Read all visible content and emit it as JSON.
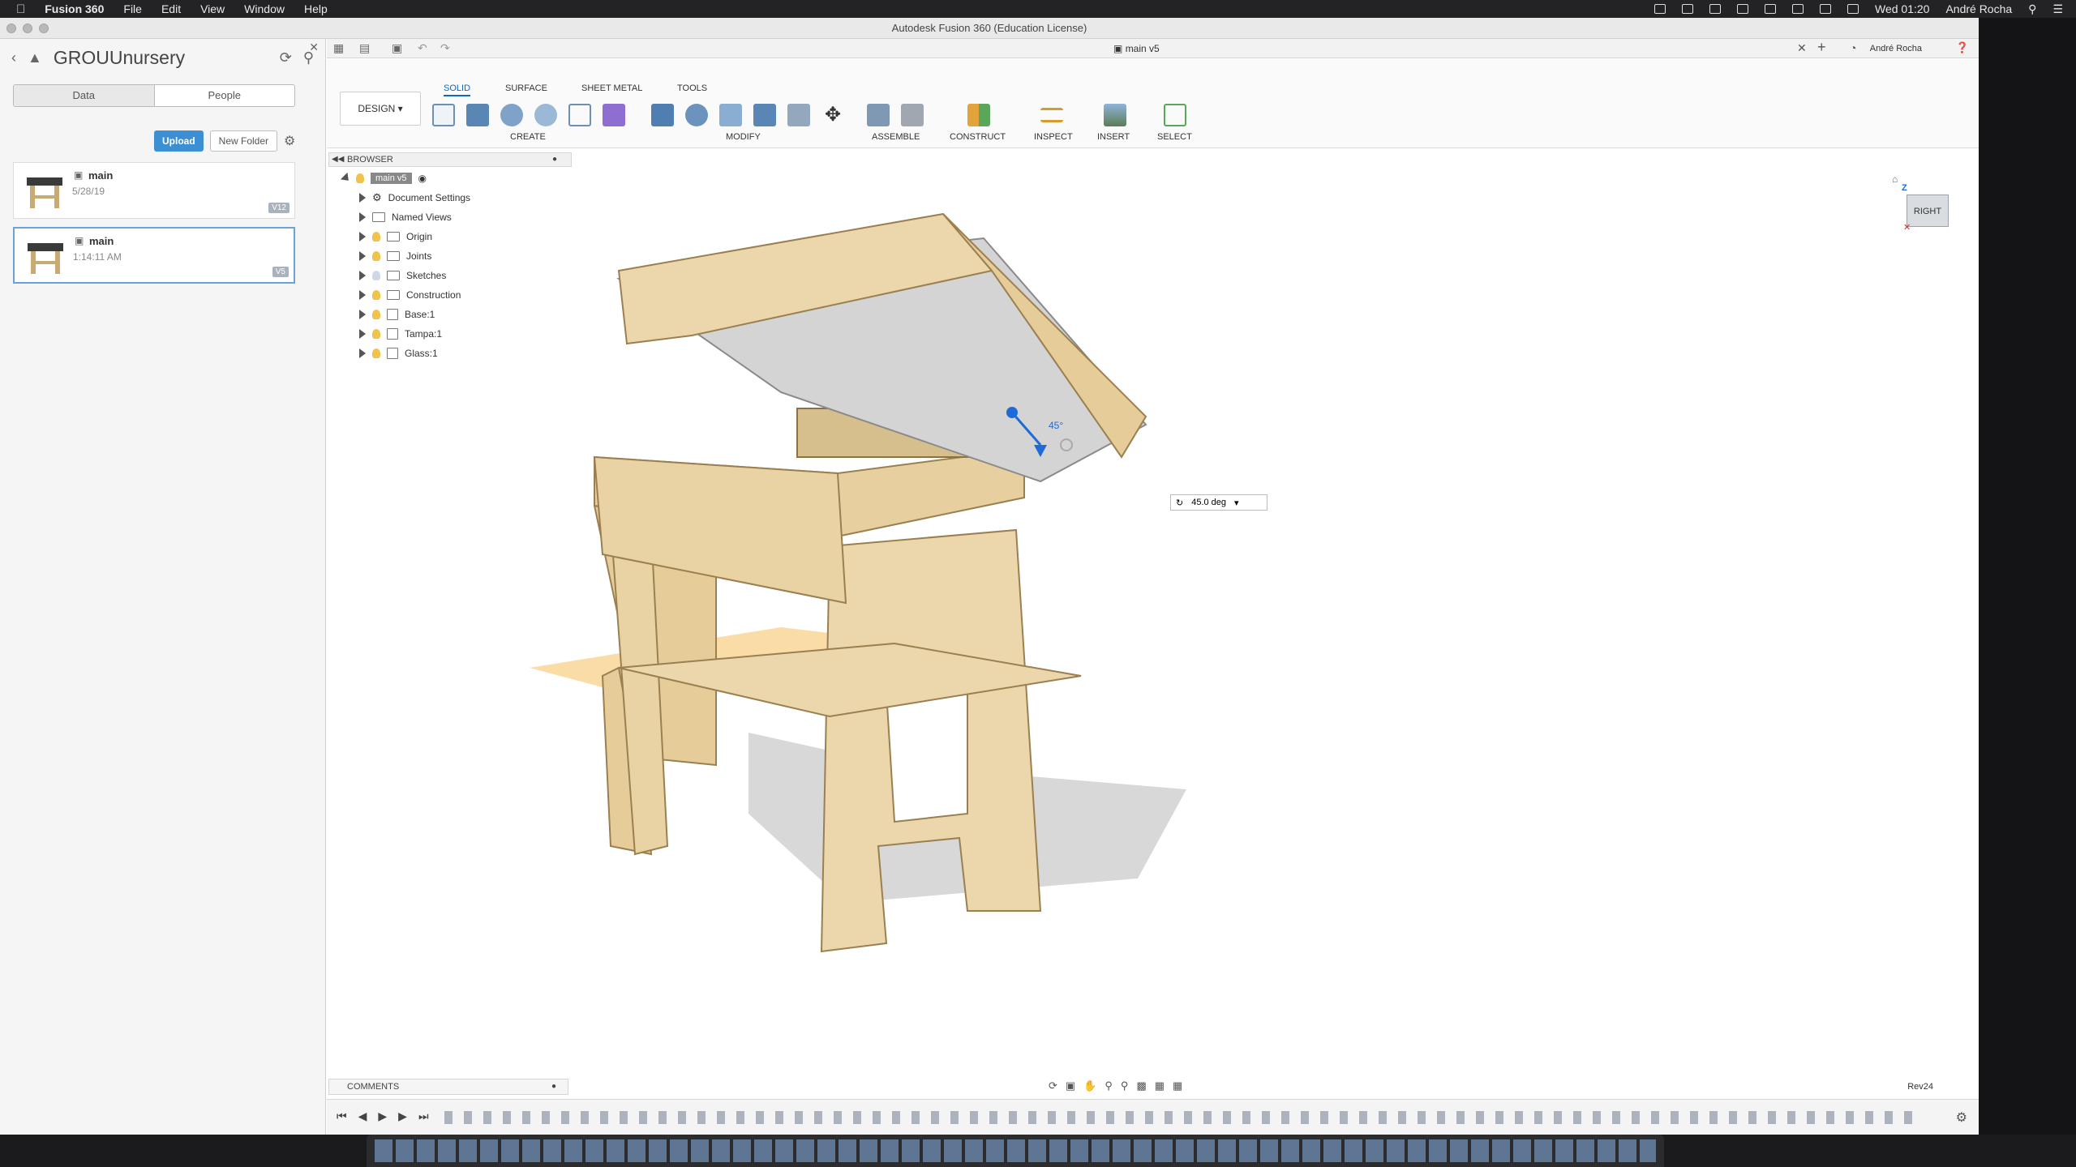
{
  "menubar": {
    "apple": "",
    "app": "Fusion 360",
    "items": [
      "File",
      "Edit",
      "View",
      "Window",
      "Help"
    ],
    "clock": "Wed 01:20",
    "user": "André Rocha"
  },
  "window": {
    "title": "Autodesk Fusion 360 (Education License)"
  },
  "datapanel": {
    "project": "GROUUnursery",
    "tab_data": "Data",
    "tab_people": "People",
    "upload": "Upload",
    "new_folder": "New Folder",
    "files": [
      {
        "name": "main",
        "date": "5/28/19",
        "version": "V12"
      },
      {
        "name": "main",
        "date": "1:14:11 AM",
        "version": "V5"
      }
    ]
  },
  "doc": {
    "tab": "main v5",
    "user": "André Rocha"
  },
  "toolbar": {
    "workspace": "DESIGN",
    "tabs": [
      "SOLID",
      "SURFACE",
      "SHEET METAL",
      "TOOLS"
    ],
    "groups": [
      "CREATE",
      "MODIFY",
      "ASSEMBLE",
      "CONSTRUCT",
      "INSPECT",
      "INSERT",
      "SELECT"
    ]
  },
  "browser": {
    "title": "BROWSER",
    "root": "main v5",
    "nodes": [
      "Document Settings",
      "Named Views",
      "Origin",
      "Joints",
      "Sketches",
      "Construction",
      "Base:1",
      "Tampa:1",
      "Glass:1"
    ]
  },
  "viewport": {
    "angle_value": "45.0 deg",
    "angle_label": "45°",
    "viewcube_face": "RIGHT",
    "axis_z": "Z"
  },
  "comments": {
    "title": "COMMENTS"
  },
  "status": {
    "rev": "Rev24"
  },
  "colors": {
    "accent": "#0b69c7",
    "wood": "#e9d2a4",
    "wood_dark": "#c9aa72"
  }
}
